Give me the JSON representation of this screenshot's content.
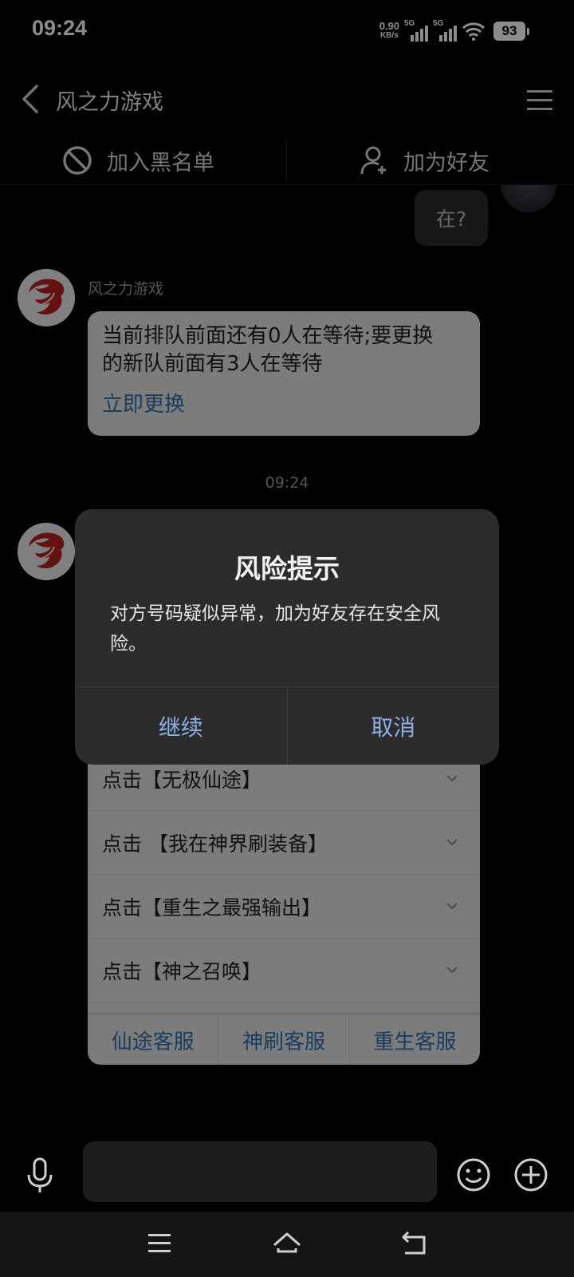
{
  "status_bar": {
    "time": "09:24",
    "net_speed_value": "0.90",
    "net_speed_unit": "KB/s",
    "sim1_label": "5G",
    "sim2_label": "5G",
    "battery": "93"
  },
  "header": {
    "title": "风之力游戏"
  },
  "actions": {
    "blacklist_label": "加入黑名单",
    "add_friend_label": "加为好友"
  },
  "chat": {
    "my_message": "在?",
    "sender_name": "风之力游戏",
    "message_line1": "当前排队前面还有0人在等待;要更换",
    "message_line2": "的新队前面有3人在等待",
    "message_link": "立即更换",
    "timestamp": "09:24",
    "menu_items": [
      "点击【无极仙途】",
      "点击 【我在神界刷装备】",
      "点击【重生之最强输出】",
      "点击【神之召唤】"
    ],
    "service_tabs": [
      "仙途客服",
      "神刷客服",
      "重生客服"
    ]
  },
  "dialog": {
    "title": "风险提示",
    "message": "对方号码疑似异常，加为好友存在安全风险。",
    "continue_label": "继续",
    "cancel_label": "取消"
  },
  "colors": {
    "link": "#2f6fb0",
    "dialog_button": "#8fb0e4",
    "dialog_bg": "#2c2c2c",
    "bubble_bg": "#e2e2e2"
  }
}
